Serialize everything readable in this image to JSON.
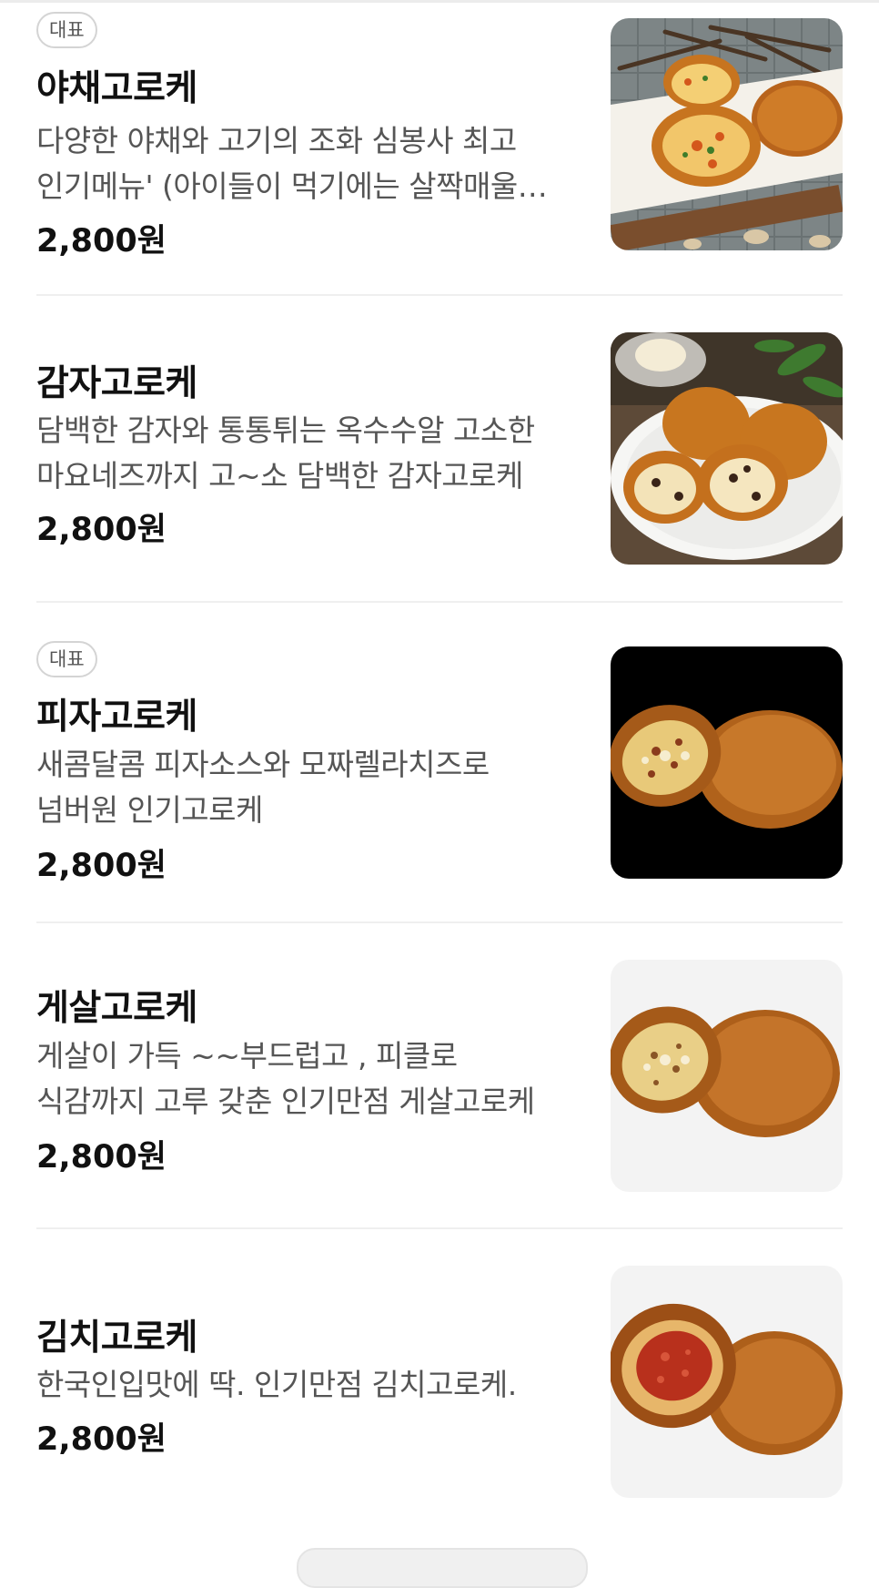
{
  "menu": {
    "items": [
      {
        "badge": "대표",
        "name": "야채고로케",
        "description": "다양한 야채와 고기의 조화 심봉사 최고 인기메뉴' (아이들이 먹기에는 살짝매울수 있어요)",
        "price": "2,800원"
      },
      {
        "badge": "",
        "name": "감자고로케",
        "description": "담백한 감자와 통통튀는 옥수수알 고소한 마요네즈까지 고~소 담백한 감자고로케",
        "price": "2,800원"
      },
      {
        "badge": "대표",
        "name": "피자고로케",
        "description": "새콤달콤 피자소스와 모짜렐라치즈로 넘버원 인기고로케",
        "price": "2,800원"
      },
      {
        "badge": "",
        "name": "게살고로케",
        "description": "게살이 가득 ~~부드럽고 , 피클로 식감까지 고루 갖춘 인기만점 게살고로케",
        "price": "2,800원"
      },
      {
        "badge": "",
        "name": "김치고로케",
        "description": "한국인입맛에 딱. 인기만점 김치고로케.",
        "price": "2,800원"
      }
    ]
  },
  "colors": {
    "text_primary": "#111111",
    "text_secondary": "#555555",
    "divider": "#efefef",
    "badge_border": "#d4d4d4"
  },
  "icons": {
    "thumbnails": [
      "croquette-photo",
      "croquette-photo",
      "croquette-photo",
      "croquette-photo",
      "croquette-photo"
    ]
  }
}
